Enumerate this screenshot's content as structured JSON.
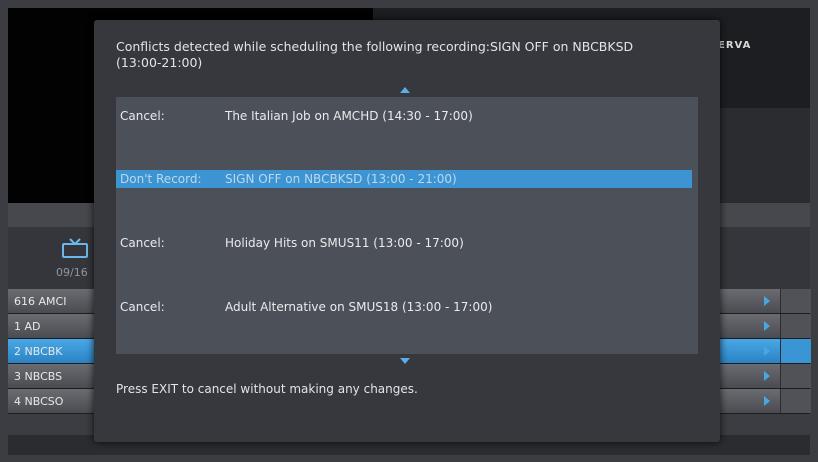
{
  "background": {
    "brand": "ERVA",
    "date": "09/16",
    "channels": [
      "616 AMCI",
      "1 AD",
      "2 NBCBK",
      "3 NBCBS",
      "4 NBCSO"
    ],
    "selected_channel_index": 2
  },
  "dialog": {
    "title": "Conflicts detected while scheduling the following recording:SIGN OFF on NBCBKSD (13:00-21:00)",
    "items": [
      {
        "action": "Cancel:",
        "description": "The Italian Job on AMCHD (14:30 - 17:00)",
        "selected": false
      },
      {
        "action": "Don't Record:",
        "description": "SIGN OFF on NBCBKSD (13:00 - 21:00)",
        "selected": true
      },
      {
        "action": "Cancel:",
        "description": "Holiday Hits on SMUS11 (13:00 - 17:00)",
        "selected": false
      },
      {
        "action": "Cancel:",
        "description": "Adult Alternative on SMUS18 (13:00 - 17:00)",
        "selected": false
      }
    ],
    "footer": "Press EXIT to cancel without making any changes."
  },
  "icons": {
    "tv": "tv-icon",
    "scroll_up": "scroll-up-arrow-icon",
    "scroll_down": "scroll-down-arrow-icon",
    "row_arrow": "play-arrow-icon"
  },
  "colors": {
    "accent": "#3c94d2",
    "dialog_bg": "#36383d",
    "list_bg": "#4c5058"
  }
}
